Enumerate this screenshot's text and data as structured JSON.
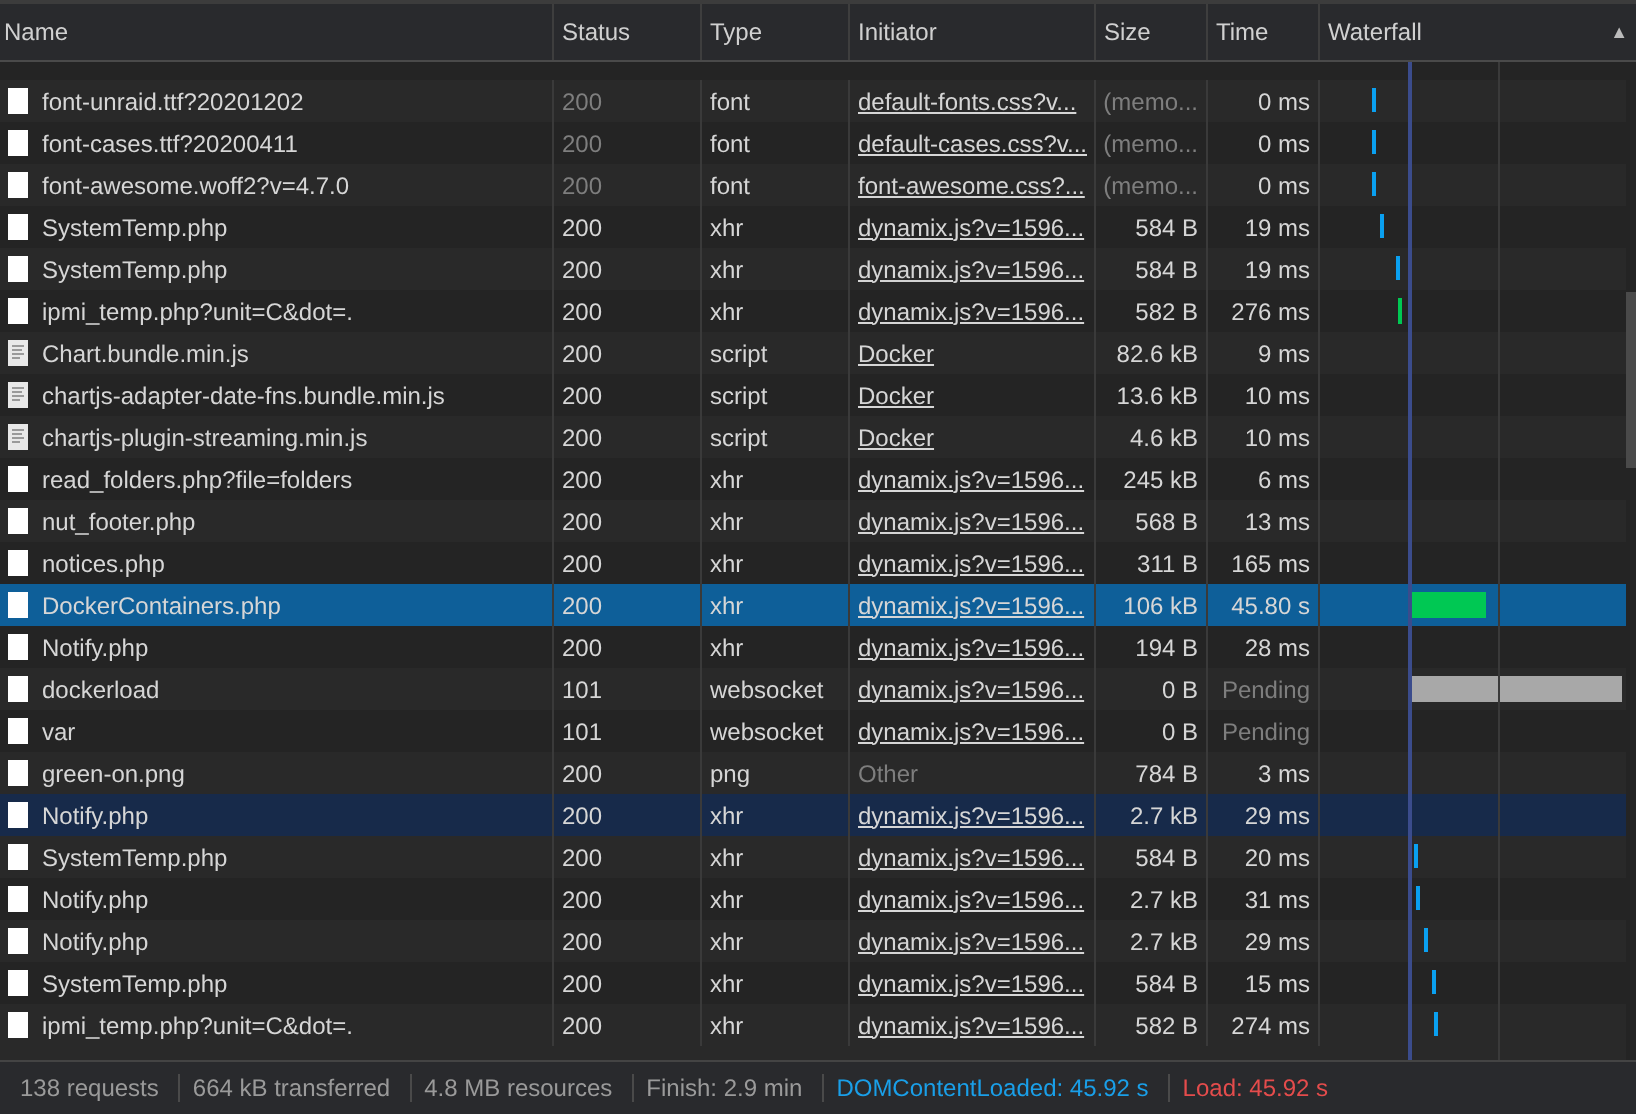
{
  "table": {
    "columns": [
      {
        "label": "Name"
      },
      {
        "label": "Status"
      },
      {
        "label": "Type"
      },
      {
        "label": "Initiator"
      },
      {
        "label": "Size"
      },
      {
        "label": "Time"
      },
      {
        "label": "Waterfall",
        "sort_indicator": "▲"
      }
    ],
    "rows": [
      {
        "kind": "document",
        "name": "font-unraid.ttf?20201202",
        "status": "200",
        "type": "font",
        "initiator": "default-fonts.css?v...",
        "initiator_link": true,
        "size": "(memo...",
        "time": "0 ms",
        "cached": true,
        "pending": false,
        "selected": false,
        "hovered": false
      },
      {
        "kind": "document",
        "name": "font-cases.ttf?20200411",
        "status": "200",
        "type": "font",
        "initiator": "default-cases.css?v...",
        "initiator_link": true,
        "size": "(memo...",
        "time": "0 ms",
        "cached": true,
        "pending": false,
        "selected": false,
        "hovered": false
      },
      {
        "kind": "document",
        "name": "font-awesome.woff2?v=4.7.0",
        "status": "200",
        "type": "font",
        "initiator": "font-awesome.css?...",
        "initiator_link": true,
        "size": "(memo...",
        "time": "0 ms",
        "cached": true,
        "pending": false,
        "selected": false,
        "hovered": false
      },
      {
        "kind": "document",
        "name": "SystemTemp.php",
        "status": "200",
        "type": "xhr",
        "initiator": "dynamix.js?v=1596...",
        "initiator_link": true,
        "size": "584 B",
        "time": "19 ms",
        "cached": false,
        "pending": false,
        "selected": false,
        "hovered": false
      },
      {
        "kind": "document",
        "name": "SystemTemp.php",
        "status": "200",
        "type": "xhr",
        "initiator": "dynamix.js?v=1596...",
        "initiator_link": true,
        "size": "584 B",
        "time": "19 ms",
        "cached": false,
        "pending": false,
        "selected": false,
        "hovered": false
      },
      {
        "kind": "document",
        "name": "ipmi_temp.php?unit=C&dot=.",
        "status": "200",
        "type": "xhr",
        "initiator": "dynamix.js?v=1596...",
        "initiator_link": true,
        "size": "582 B",
        "time": "276 ms",
        "cached": false,
        "pending": false,
        "selected": false,
        "hovered": false
      },
      {
        "kind": "script",
        "name": "Chart.bundle.min.js",
        "status": "200",
        "type": "script",
        "initiator": "Docker",
        "initiator_link": true,
        "size": "82.6 kB",
        "time": "9 ms",
        "cached": false,
        "pending": false,
        "selected": false,
        "hovered": false
      },
      {
        "kind": "script",
        "name": "chartjs-adapter-date-fns.bundle.min.js",
        "status": "200",
        "type": "script",
        "initiator": "Docker",
        "initiator_link": true,
        "size": "13.6 kB",
        "time": "10 ms",
        "cached": false,
        "pending": false,
        "selected": false,
        "hovered": false
      },
      {
        "kind": "script",
        "name": "chartjs-plugin-streaming.min.js",
        "status": "200",
        "type": "script",
        "initiator": "Docker",
        "initiator_link": true,
        "size": "4.6 kB",
        "time": "10 ms",
        "cached": false,
        "pending": false,
        "selected": false,
        "hovered": false
      },
      {
        "kind": "document",
        "name": "read_folders.php?file=folders",
        "status": "200",
        "type": "xhr",
        "initiator": "dynamix.js?v=1596...",
        "initiator_link": true,
        "size": "245 kB",
        "time": "6 ms",
        "cached": false,
        "pending": false,
        "selected": false,
        "hovered": false
      },
      {
        "kind": "document",
        "name": "nut_footer.php",
        "status": "200",
        "type": "xhr",
        "initiator": "dynamix.js?v=1596...",
        "initiator_link": true,
        "size": "568 B",
        "time": "13 ms",
        "cached": false,
        "pending": false,
        "selected": false,
        "hovered": false
      },
      {
        "kind": "document",
        "name": "notices.php",
        "status": "200",
        "type": "xhr",
        "initiator": "dynamix.js?v=1596...",
        "initiator_link": true,
        "size": "311 B",
        "time": "165 ms",
        "cached": false,
        "pending": false,
        "selected": false,
        "hovered": false
      },
      {
        "kind": "document",
        "name": "DockerContainers.php",
        "status": "200",
        "type": "xhr",
        "initiator": "dynamix.js?v=1596...",
        "initiator_link": true,
        "size": "106 kB",
        "time": "45.80 s",
        "cached": false,
        "pending": false,
        "selected": true,
        "hovered": false
      },
      {
        "kind": "document",
        "name": "Notify.php",
        "status": "200",
        "type": "xhr",
        "initiator": "dynamix.js?v=1596...",
        "initiator_link": true,
        "size": "194 B",
        "time": "28 ms",
        "cached": false,
        "pending": false,
        "selected": false,
        "hovered": false
      },
      {
        "kind": "document",
        "name": "dockerload",
        "status": "101",
        "type": "websocket",
        "initiator": "dynamix.js?v=1596...",
        "initiator_link": true,
        "size": "0 B",
        "time": "Pending",
        "cached": false,
        "pending": true,
        "selected": false,
        "hovered": false
      },
      {
        "kind": "document",
        "name": "var",
        "status": "101",
        "type": "websocket",
        "initiator": "dynamix.js?v=1596...",
        "initiator_link": true,
        "size": "0 B",
        "time": "Pending",
        "cached": false,
        "pending": true,
        "selected": false,
        "hovered": false
      },
      {
        "kind": "document",
        "name": "green-on.png",
        "status": "200",
        "type": "png",
        "initiator": "Other",
        "initiator_link": false,
        "size": "784 B",
        "time": "3 ms",
        "cached": false,
        "pending": false,
        "selected": false,
        "hovered": false
      },
      {
        "kind": "document",
        "name": "Notify.php",
        "status": "200",
        "type": "xhr",
        "initiator": "dynamix.js?v=1596...",
        "initiator_link": true,
        "size": "2.7 kB",
        "time": "29 ms",
        "cached": false,
        "pending": false,
        "selected": false,
        "hovered": true
      },
      {
        "kind": "document",
        "name": "SystemTemp.php",
        "status": "200",
        "type": "xhr",
        "initiator": "dynamix.js?v=1596...",
        "initiator_link": true,
        "size": "584 B",
        "time": "20 ms",
        "cached": false,
        "pending": false,
        "selected": false,
        "hovered": false
      },
      {
        "kind": "document",
        "name": "Notify.php",
        "status": "200",
        "type": "xhr",
        "initiator": "dynamix.js?v=1596...",
        "initiator_link": true,
        "size": "2.7 kB",
        "time": "31 ms",
        "cached": false,
        "pending": false,
        "selected": false,
        "hovered": false
      },
      {
        "kind": "document",
        "name": "Notify.php",
        "status": "200",
        "type": "xhr",
        "initiator": "dynamix.js?v=1596...",
        "initiator_link": true,
        "size": "2.7 kB",
        "time": "29 ms",
        "cached": false,
        "pending": false,
        "selected": false,
        "hovered": false
      },
      {
        "kind": "document",
        "name": "SystemTemp.php",
        "status": "200",
        "type": "xhr",
        "initiator": "dynamix.js?v=1596...",
        "initiator_link": true,
        "size": "584 B",
        "time": "15 ms",
        "cached": false,
        "pending": false,
        "selected": false,
        "hovered": false
      },
      {
        "kind": "document",
        "name": "ipmi_temp.php?unit=C&dot=.",
        "status": "200",
        "type": "xhr",
        "initiator": "dynamix.js?v=1596...",
        "initiator_link": true,
        "size": "582 B",
        "time": "274 ms",
        "cached": false,
        "pending": false,
        "selected": false,
        "hovered": false
      }
    ]
  },
  "status_bar": [
    {
      "text": "138 requests"
    },
    {
      "text": "664 kB transferred"
    },
    {
      "text": "4.8 MB resources"
    },
    {
      "text": "Finish: 2.9 min"
    },
    {
      "text": "DOMContentLoaded: 45.92 s",
      "color": "#1a9fe8"
    },
    {
      "text": "Load: 45.92 s",
      "color": "#e44c4c"
    }
  ]
}
